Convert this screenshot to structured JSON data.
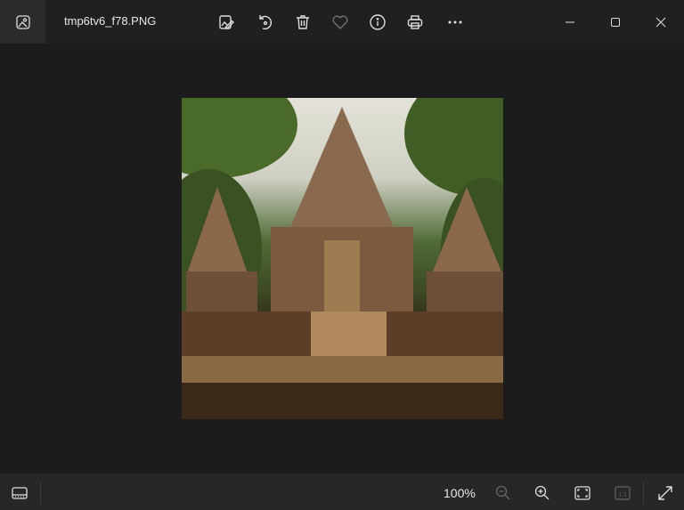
{
  "window": {
    "title": "tmp6tv6_f78.PNG"
  },
  "toolbar": {
    "icons": [
      "edit-image-icon",
      "rotate-icon",
      "delete-icon",
      "favorite-icon",
      "info-icon",
      "print-icon",
      "more-icon"
    ]
  },
  "window_controls": [
    "minimize",
    "maximize",
    "close"
  ],
  "statusbar": {
    "zoom_level": "100%"
  },
  "colors": {
    "background": "#1c1c1c",
    "titlebar": "#202020",
    "bottombar": "#272727"
  }
}
